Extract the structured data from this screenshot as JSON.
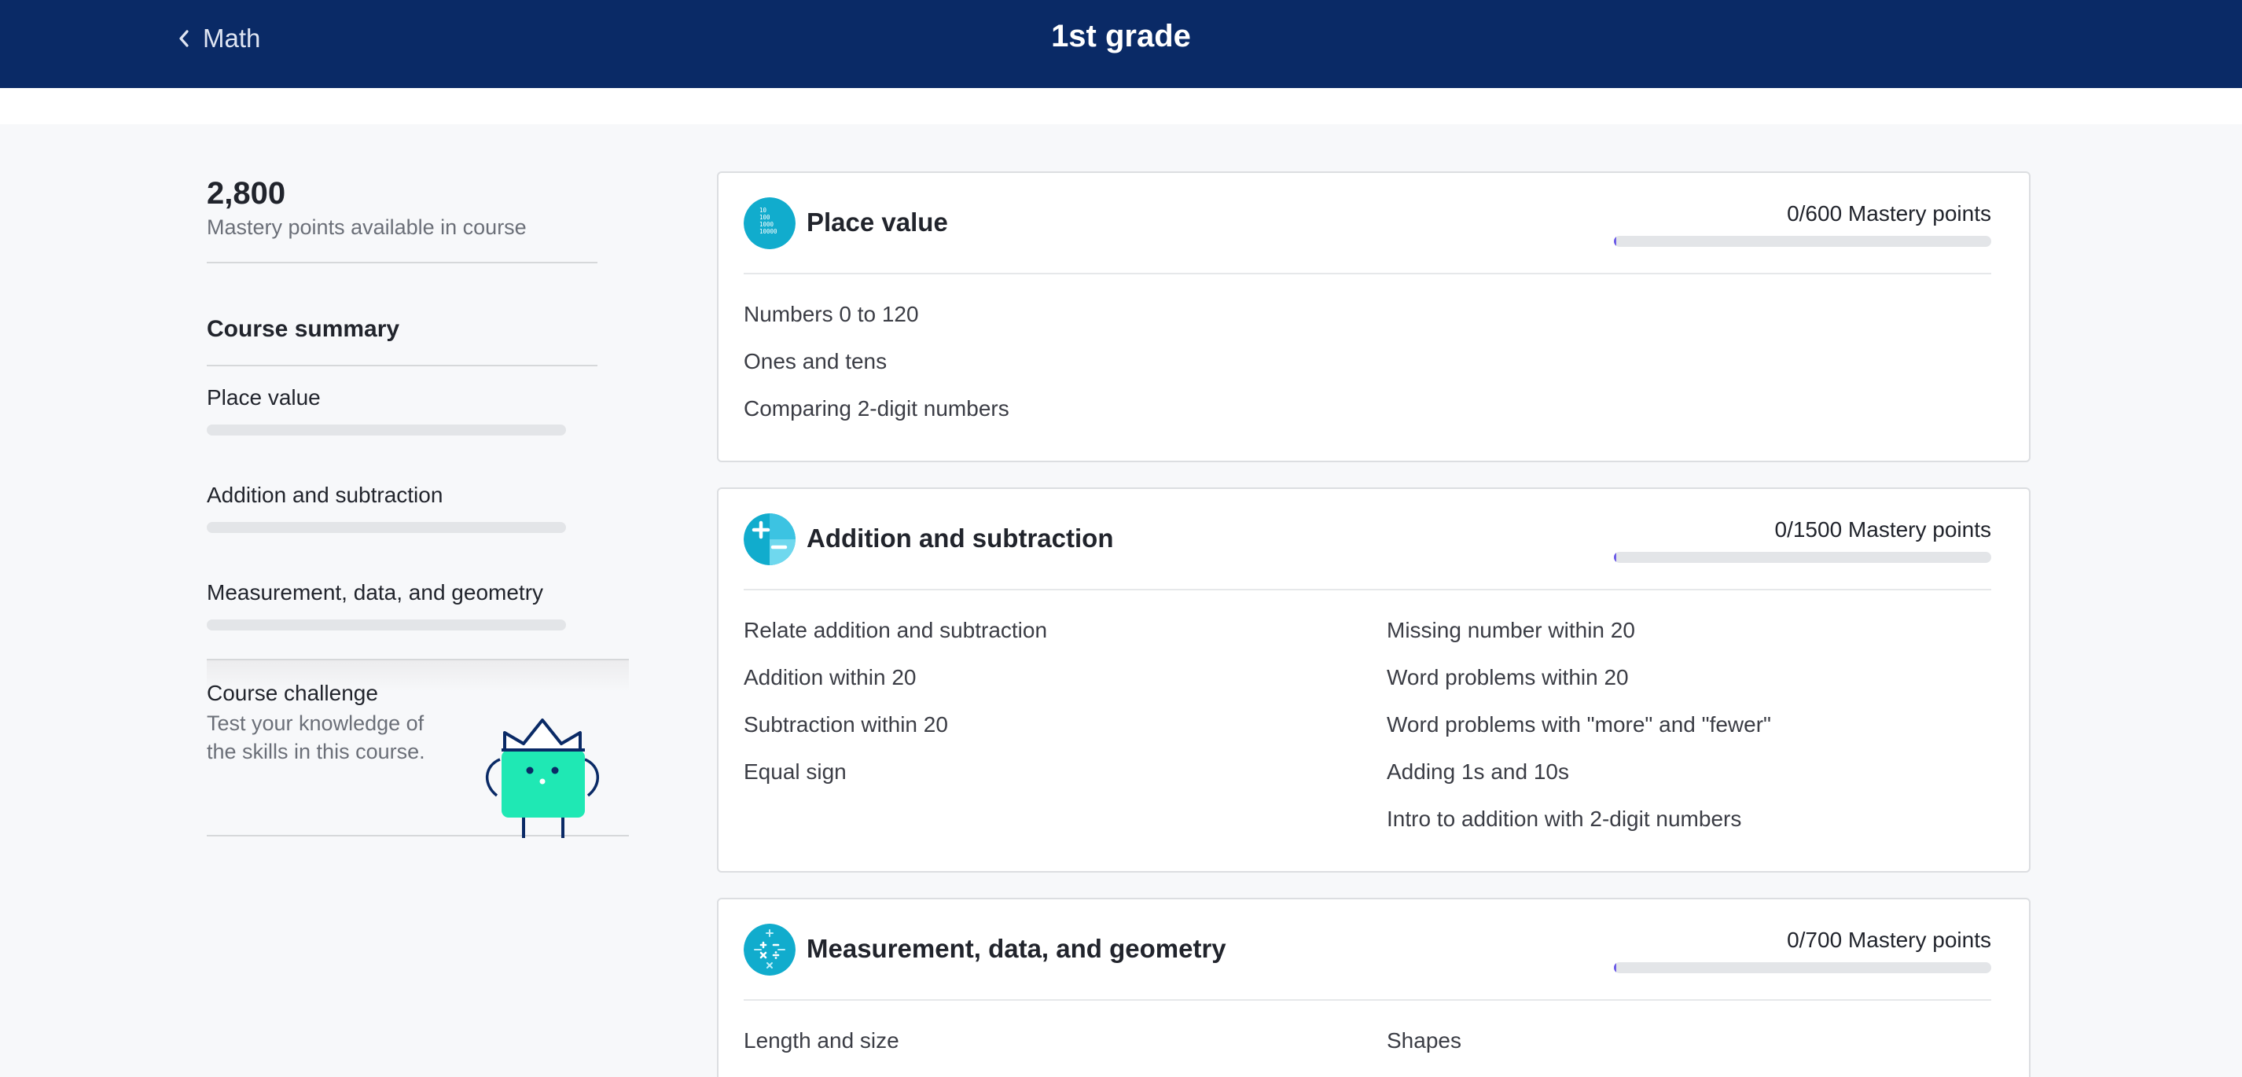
{
  "header": {
    "back_label": "Math",
    "title": "1st grade"
  },
  "sidebar": {
    "points_total": "2,800",
    "points_caption": "Mastery points available in course",
    "summary_heading": "Course summary",
    "items": [
      {
        "label": "Place value",
        "progress": 0
      },
      {
        "label": "Addition and subtraction",
        "progress": 0
      },
      {
        "label": "Measurement, data, and geometry",
        "progress": 0
      }
    ],
    "challenge": {
      "title": "Course challenge",
      "description": "Test your knowledge of the skills in this course."
    }
  },
  "units": [
    {
      "title": "Place value",
      "points": "0/600 Mastery points",
      "progress": 0,
      "icon": "place-value-icon",
      "icon_text": [
        "10",
        "100",
        "1000",
        "10000"
      ],
      "skills_left": [
        "Numbers 0 to 120",
        "Ones and tens",
        "Comparing 2-digit numbers"
      ],
      "skills_right": []
    },
    {
      "title": "Addition and subtraction",
      "points": "0/1500 Mastery points",
      "progress": 0,
      "icon": "plus-minus-icon",
      "skills_left": [
        "Relate addition and subtraction",
        "Addition within 20",
        "Subtraction within 20",
        "Equal sign"
      ],
      "skills_right": [
        "Missing number within 20",
        "Word problems within 20",
        "Word problems with \"more\" and \"fewer\"",
        "Adding 1s and 10s",
        "Intro to addition with 2-digit numbers"
      ]
    },
    {
      "title": "Measurement, data, and geometry",
      "points": "0/700 Mastery points",
      "progress": 0,
      "icon": "math-symbols-icon",
      "skills_left": [
        "Length and size"
      ],
      "skills_right": [
        "Shapes"
      ]
    }
  ],
  "colors": {
    "header_bg": "#0a2a66",
    "icon_teal": "#11accd",
    "mascot_green": "#1fe8b4",
    "progress_fill": "#6c5ce7"
  }
}
